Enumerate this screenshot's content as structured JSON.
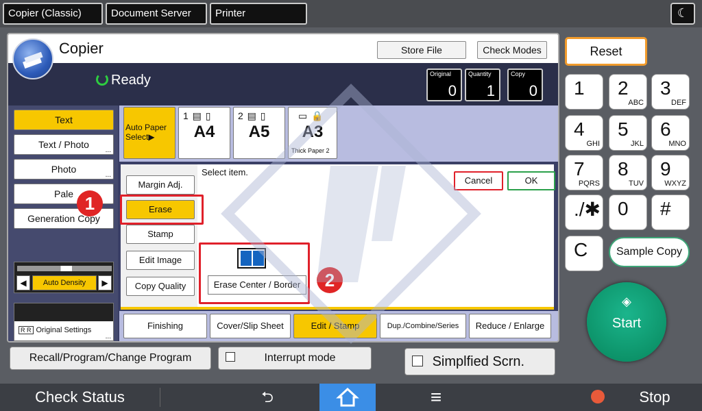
{
  "topbar": {
    "tabs": [
      "Copier (Classic)",
      "Document Server",
      "Printer"
    ],
    "night_icon": "moon-icon"
  },
  "header": {
    "title": "Copier",
    "store_file": "Store File",
    "check_modes": "Check Modes",
    "status": "Ready"
  },
  "counters": [
    {
      "label": "Original",
      "value": "0"
    },
    {
      "label": "Quantity",
      "value": "1"
    },
    {
      "label": "Copy",
      "value": "0"
    }
  ],
  "modes": [
    {
      "label": "Text",
      "selected": true,
      "dots": ""
    },
    {
      "label": "Text / Photo",
      "selected": false,
      "dots": "..."
    },
    {
      "label": "Photo",
      "selected": false,
      "dots": "..."
    },
    {
      "label": "Pale",
      "selected": false,
      "dots": ""
    },
    {
      "label": "Generation Copy",
      "selected": false,
      "dots": ""
    }
  ],
  "density": {
    "label": "Auto Density",
    "left": "◀",
    "right": "▶"
  },
  "original_settings": {
    "label": "Original Settings",
    "icon": "R R",
    "dots": "..."
  },
  "paper": {
    "auto": "Auto Paper Select▶",
    "trays": [
      {
        "tray": "1 ▤ ▯",
        "size": "A4",
        "note": ""
      },
      {
        "tray": "2 ▤ ▯",
        "size": "A5",
        "note": ""
      },
      {
        "tray": "▭ 🔒",
        "size": "A3",
        "note": "Thick Paper 2"
      }
    ]
  },
  "functions": [
    "Margin Adj.",
    "Erase",
    "Stamp",
    "Edit Image",
    "Copy Quality"
  ],
  "selected_function": "Erase",
  "dialog": {
    "prompt": "Select item.",
    "cancel": "Cancel",
    "ok": "OK",
    "erase_center_border": "Erase Center / Border",
    "erase_dots": "..."
  },
  "badges": [
    "1",
    "2"
  ],
  "bottom_tabs": [
    "Finishing",
    "Cover/Slip Sheet",
    "Edit / Stamp",
    "Dup./Combine/Series",
    "Reduce / Enlarge"
  ],
  "selected_tab": "Edit / Stamp",
  "keypad": {
    "reset": "Reset",
    "keys": [
      {
        "num": "1",
        "sub": ""
      },
      {
        "num": "2",
        "sub": "ABC"
      },
      {
        "num": "3",
        "sub": "DEF"
      },
      {
        "num": "4",
        "sub": "GHI"
      },
      {
        "num": "5",
        "sub": "JKL"
      },
      {
        "num": "6",
        "sub": "MNO"
      },
      {
        "num": "7",
        "sub": "PQRS"
      },
      {
        "num": "8",
        "sub": "TUV"
      },
      {
        "num": "9",
        "sub": "WXYZ"
      },
      {
        "num": "./✱",
        "sub": ""
      },
      {
        "num": "0",
        "sub": ""
      },
      {
        "num": "#",
        "sub": ""
      },
      {
        "num": "C",
        "sub": ""
      }
    ],
    "sample_copy": "Sample Copy",
    "start": "Start"
  },
  "controls": {
    "recall": "Recall/Program/Change Program",
    "interrupt": "Interrupt mode",
    "simplified": "Simplfied Scrn."
  },
  "footer": {
    "check_status": "Check Status",
    "back_icon": "⮌",
    "home_icon": "home-icon",
    "menu_icon": "≡",
    "stop": "Stop"
  },
  "colors": {
    "accent_yellow": "#f7c700",
    "start_green": "#0a9b6c",
    "highlight_red": "#e0202a",
    "home_blue": "#3b8ee6"
  }
}
